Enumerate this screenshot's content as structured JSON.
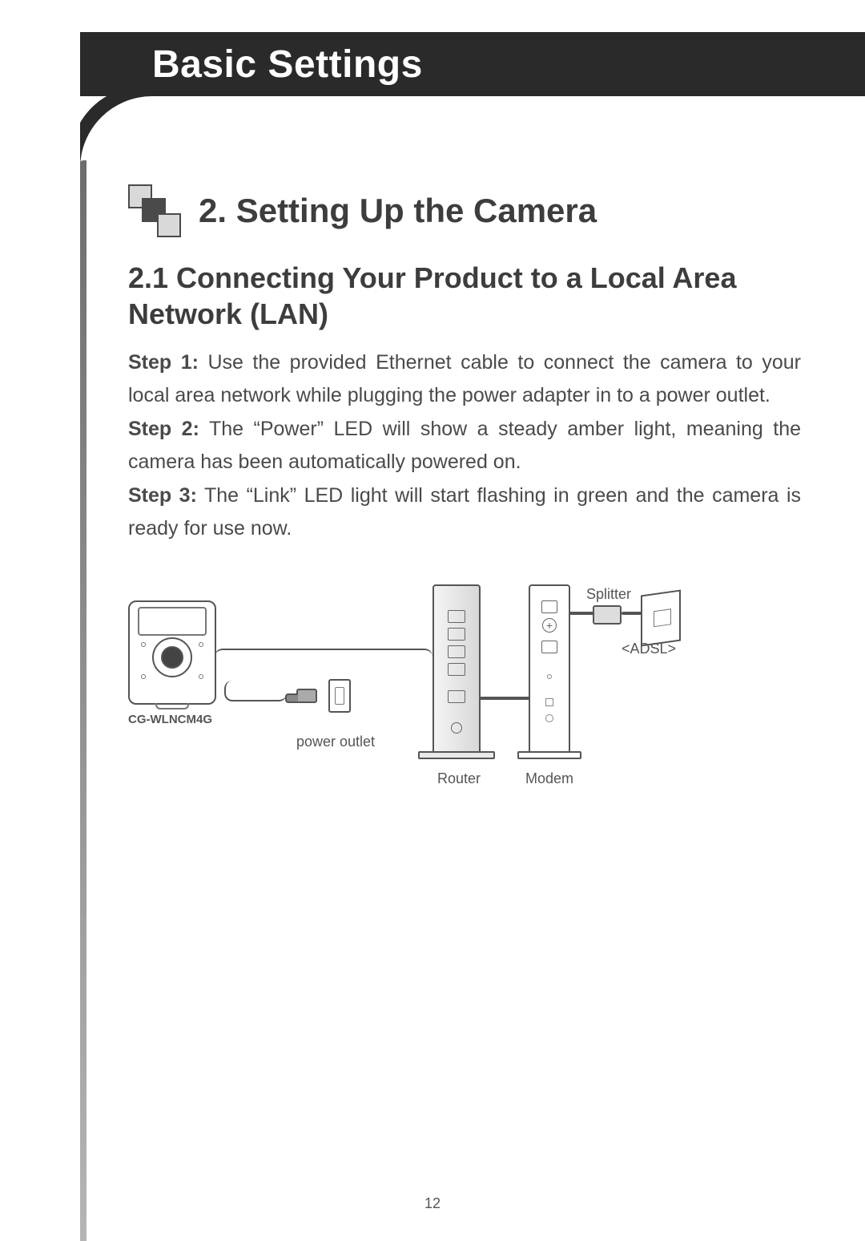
{
  "header": {
    "title": "Basic Settings"
  },
  "section": {
    "number_title": "2. Setting Up the Camera",
    "subsection_title": "2.1 Connecting Your Product to a Local Area Network (LAN)"
  },
  "steps": [
    {
      "label": "Step 1:",
      "text": " Use the provided Ethernet cable to connect the camera to your local area network while plugging the power adapter in to a power outlet."
    },
    {
      "label": "Step 2:",
      "text": " The “Power” LED will show a steady amber light, meaning the camera has been automatically powered on."
    },
    {
      "label": "Step 3:",
      "text": " The “Link” LED light will start flashing in green and the camera is ready for use now."
    }
  ],
  "diagram": {
    "camera_model": "CG-WLNCM4G",
    "power_outlet": "power outlet",
    "router": "Router",
    "modem": "Modem",
    "splitter": "Splitter",
    "adsl": "<ADSL>"
  },
  "page_number": "12"
}
